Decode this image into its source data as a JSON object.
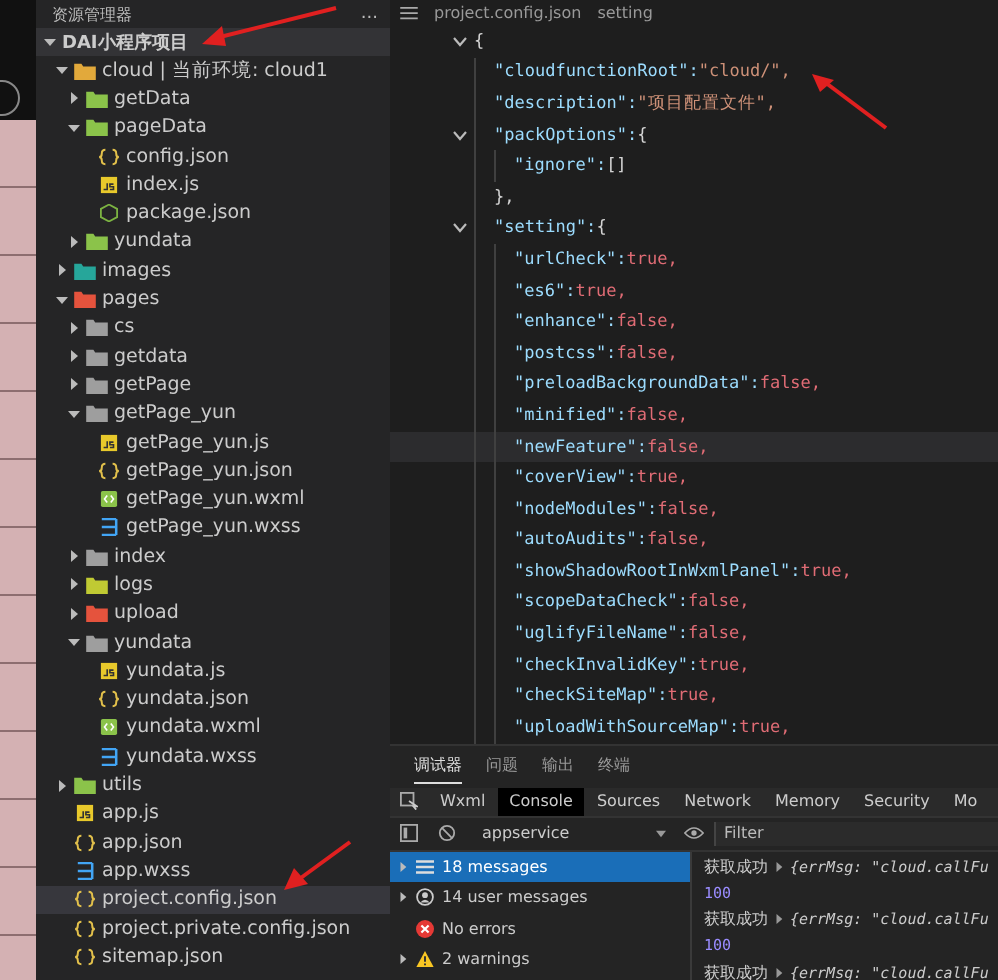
{
  "explorer": {
    "title": "资源管理器",
    "more": "...",
    "project": "DAI小程序项目",
    "tree": [
      {
        "label": "cloud | 当前环境: cloud1",
        "kind": "folder",
        "expanded": true,
        "selected": false,
        "children": [
          {
            "label": "getData",
            "kind": "folder",
            "expanded": false,
            "selected": false
          },
          {
            "label": "pageData",
            "kind": "folder",
            "expanded": true,
            "selected": false,
            "children": [
              {
                "label": "config.json",
                "kind": "json",
                "selected": false
              },
              {
                "label": "index.js",
                "kind": "js",
                "selected": false
              },
              {
                "label": "package.json",
                "kind": "npm",
                "selected": false
              }
            ]
          },
          {
            "label": "yundata",
            "kind": "folder",
            "expanded": false,
            "selected": false
          }
        ]
      },
      {
        "label": "images",
        "kind": "folder",
        "expanded": false,
        "selected": false
      },
      {
        "label": "pages",
        "kind": "folder",
        "expanded": true,
        "selected": false,
        "children": [
          {
            "label": "cs",
            "kind": "folder",
            "expanded": false,
            "selected": false
          },
          {
            "label": "getdata",
            "kind": "folder",
            "expanded": false,
            "selected": false
          },
          {
            "label": "getPage",
            "kind": "folder",
            "expanded": false,
            "selected": false
          },
          {
            "label": "getPage_yun",
            "kind": "folder",
            "expanded": true,
            "selected": false,
            "children": [
              {
                "label": "getPage_yun.js",
                "kind": "js",
                "selected": false
              },
              {
                "label": "getPage_yun.json",
                "kind": "json",
                "selected": false
              },
              {
                "label": "getPage_yun.wxml",
                "kind": "wxml",
                "selected": false
              },
              {
                "label": "getPage_yun.wxss",
                "kind": "wxss",
                "selected": false
              }
            ]
          },
          {
            "label": "index",
            "kind": "folder",
            "expanded": false,
            "selected": false
          },
          {
            "label": "logs",
            "kind": "folder",
            "expanded": false,
            "selected": false
          },
          {
            "label": "upload",
            "kind": "folder",
            "expanded": false,
            "selected": false
          },
          {
            "label": "yundata",
            "kind": "folder",
            "expanded": true,
            "selected": false,
            "children": [
              {
                "label": "yundata.js",
                "kind": "js",
                "selected": false
              },
              {
                "label": "yundata.json",
                "kind": "json",
                "selected": false
              },
              {
                "label": "yundata.wxml",
                "kind": "wxml",
                "selected": false
              },
              {
                "label": "yundata.wxss",
                "kind": "wxss",
                "selected": false
              }
            ]
          }
        ]
      },
      {
        "label": "utils",
        "kind": "folder",
        "expanded": false,
        "selected": false
      },
      {
        "label": "app.js",
        "kind": "js",
        "selected": false
      },
      {
        "label": "app.json",
        "kind": "json",
        "selected": false
      },
      {
        "label": "app.wxss",
        "kind": "wxss",
        "selected": false
      },
      {
        "label": "project.config.json",
        "kind": "json",
        "selected": true
      },
      {
        "label": "project.private.config.json",
        "kind": "json",
        "selected": false
      },
      {
        "label": "sitemap.json",
        "kind": "json",
        "selected": false
      }
    ]
  },
  "editor": {
    "breadcrumb": [
      "project.config.json",
      "setting"
    ],
    "code": [
      {
        "punct": "{",
        "expanded": true,
        "current": false,
        "children": [
          {
            "key": "\"cloudfunctionRoot\":",
            "string": "\"cloud/\",",
            "current": false
          },
          {
            "key": "\"description\":",
            "string": "\"项目配置文件\",",
            "current": false
          },
          {
            "key": "\"packOptions\":",
            "punct": "{",
            "expanded": true,
            "current": false,
            "close": "},",
            "children": [
              {
                "key": "\"ignore\":",
                "punct": "[]",
                "current": false
              }
            ]
          },
          {
            "key": "\"setting\":",
            "punct": "{",
            "expanded": true,
            "current": false,
            "children": [
              {
                "key": "\"urlCheck\":",
                "literal": "true,",
                "current": false
              },
              {
                "key": "\"es6\":",
                "literal": "true,",
                "current": false
              },
              {
                "key": "\"enhance\":",
                "literal": "false,",
                "current": false
              },
              {
                "key": "\"postcss\":",
                "literal": "false,",
                "current": false
              },
              {
                "key": "\"preloadBackgroundData\":",
                "literal": "false,",
                "current": false
              },
              {
                "key": "\"minified\":",
                "literal": "false,",
                "current": false
              },
              {
                "key": "\"newFeature\":",
                "literal": "false,",
                "current": true
              },
              {
                "key": "\"coverView\":",
                "literal": "true,",
                "current": false
              },
              {
                "key": "\"nodeModules\":",
                "literal": "false,",
                "current": false
              },
              {
                "key": "\"autoAudits\":",
                "literal": "false,",
                "current": false
              },
              {
                "key": "\"showShadowRootInWxmlPanel\":",
                "literal": "true,",
                "current": false
              },
              {
                "key": "\"scopeDataCheck\":",
                "literal": "false,",
                "current": false
              },
              {
                "key": "\"uglifyFileName\":",
                "literal": "false,",
                "current": false
              },
              {
                "key": "\"checkInvalidKey\":",
                "literal": "true,",
                "current": false
              },
              {
                "key": "\"checkSiteMap\":",
                "literal": "true,",
                "current": false
              },
              {
                "key": "\"uploadWithSourceMap\":",
                "literal": "true,",
                "current": false
              }
            ]
          }
        ]
      }
    ]
  },
  "devtools": {
    "tabs": [
      {
        "label": "调试器",
        "selected": true
      },
      {
        "label": "问题",
        "selected": false
      },
      {
        "label": "输出",
        "selected": false
      },
      {
        "label": "终端",
        "selected": false
      }
    ],
    "panel_tabs": [
      {
        "label": "Wxml",
        "selected": false
      },
      {
        "label": "Console",
        "selected": true
      },
      {
        "label": "Sources",
        "selected": false
      },
      {
        "label": "Network",
        "selected": false
      },
      {
        "label": "Memory",
        "selected": false
      },
      {
        "label": "Security",
        "selected": false
      },
      {
        "label": "Mo",
        "selected": false
      }
    ],
    "context": "appservice",
    "filter": {
      "placeholder": "Filter"
    },
    "sidebar": [
      {
        "label": "18 messages",
        "kind": "list",
        "expandable": true,
        "selected": true
      },
      {
        "label": "14 user messages",
        "kind": "user",
        "expandable": true,
        "selected": false
      },
      {
        "label": "No errors",
        "kind": "error",
        "expandable": false,
        "selected": false
      },
      {
        "label": "2 warnings",
        "kind": "warning",
        "expandable": true,
        "selected": false
      }
    ],
    "messages": [
      {
        "kind": "object",
        "label": "获取成功",
        "object": "{errMsg: \"cloud.callFu"
      },
      {
        "kind": "number",
        "value": "100"
      },
      {
        "kind": "object",
        "label": "获取成功",
        "object": "{errMsg: \"cloud.callFu"
      },
      {
        "kind": "number",
        "value": "100"
      },
      {
        "kind": "object",
        "label": "获取成功",
        "object": "{errMsg: \"cloud.callFu"
      }
    ]
  }
}
